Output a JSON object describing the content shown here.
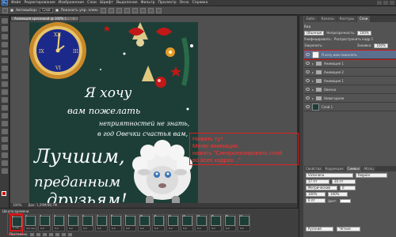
{
  "menubar": {
    "logo": "Ps",
    "items": [
      "Файл",
      "Редактирование",
      "Изображение",
      "Слои",
      "Шрифт",
      "Выделение",
      "Фильтр",
      "Просмотр",
      "Окно",
      "Справка"
    ]
  },
  "options": {
    "autoselect_label": "Автовыбор:",
    "autoselect_value": "Слой",
    "show_controls": "Показать упр. элем."
  },
  "document": {
    "tab_title": "Анимация хрескакой @ 100% (...",
    "close_glyph": "×",
    "statusbar_zoom": "100%",
    "statusbar_doc": "Док: 1,29М/48,7М"
  },
  "card": {
    "line1": "Я хочу",
    "line2": "вам пожелать",
    "line3": "неприятностей не знать,",
    "line4": "в год Овечки счастья вам,",
    "line5": "Лучшим,",
    "line6": "преданным",
    "line7": "друзьям!",
    "clock": {
      "n12": "XII",
      "n3": "III",
      "n6": "VI",
      "n9": "IX"
    }
  },
  "annotation": {
    "line1": "Нажать тут",
    "line2": "Меню анимации,",
    "line3": "нажать \"Синхронизировать слой",
    "line4": "во всех кадрах...\""
  },
  "right_panel": {
    "tabs": [
      "Библ.",
      "Каналы",
      "Контуры",
      "Слои"
    ],
    "active_tab": "Слои",
    "kind_label": "Вид",
    "blend": "Обычные",
    "opacity_label": "Непрозрачность:",
    "opacity_value": "100%",
    "unify_label": "Унифицировать:",
    "spread_label": "Распространить кадр 1",
    "lock_label": "Закрепить:",
    "fill_label": "Заливка:",
    "fill_value": "100%",
    "layers": [
      {
        "name": "Я хочу  вам пожелать",
        "kind": "text",
        "selected": true
      },
      {
        "name": "Анимация 1",
        "kind": "folder"
      },
      {
        "name": "Анимация 2",
        "kind": "folder"
      },
      {
        "name": "Анимация 1",
        "kind": "folder"
      },
      {
        "name": "Овечка",
        "kind": "folder"
      },
      {
        "name": "Новогодняя",
        "kind": "folder"
      },
      {
        "name": "Слой 1",
        "kind": "image"
      }
    ]
  },
  "char_panel": {
    "tabs": [
      "Свойства",
      "Коррекция",
      "Символ",
      "Абзац"
    ],
    "active_tab": "Символ",
    "font": "Victoriana",
    "style": "Regular",
    "size": "17 пт",
    "leading": "20 пт",
    "kerning": "Метрический",
    "tracking": "0",
    "scale_v": "100%",
    "scale_h": "100%",
    "baseline": "0 пт",
    "color_label": "Цвет:",
    "language": "Русский",
    "aa": "Чёткое"
  },
  "timeline": {
    "title": "Шкала времени",
    "frames": [
      {
        "n": "1",
        "d": "0 сек."
      },
      {
        "n": "2",
        "d": "0,2 сек."
      },
      {
        "n": "3",
        "d": "0,2"
      },
      {
        "n": "4",
        "d": "0,2"
      },
      {
        "n": "5",
        "d": "0,2"
      },
      {
        "n": "6",
        "d": "0,2"
      },
      {
        "n": "7",
        "d": "0,2"
      },
      {
        "n": "8",
        "d": "0,2"
      },
      {
        "n": "9",
        "d": "0,2"
      },
      {
        "n": "10",
        "d": "0,2"
      },
      {
        "n": "11",
        "d": "0,2"
      },
      {
        "n": "12",
        "d": "0,2"
      },
      {
        "n": "13",
        "d": "0,2"
      },
      {
        "n": "14",
        "d": "0,2"
      },
      {
        "n": "15",
        "d": "0,2"
      },
      {
        "n": "16",
        "d": "0,2"
      },
      {
        "n": "17",
        "d": "0,2"
      }
    ],
    "loop": "Постоянно"
  },
  "colors": {
    "accent_red": "#d01818",
    "card_bg": "#1d3e37",
    "clock_blue": "#1b2a8a",
    "gold": "#d9a43a"
  }
}
